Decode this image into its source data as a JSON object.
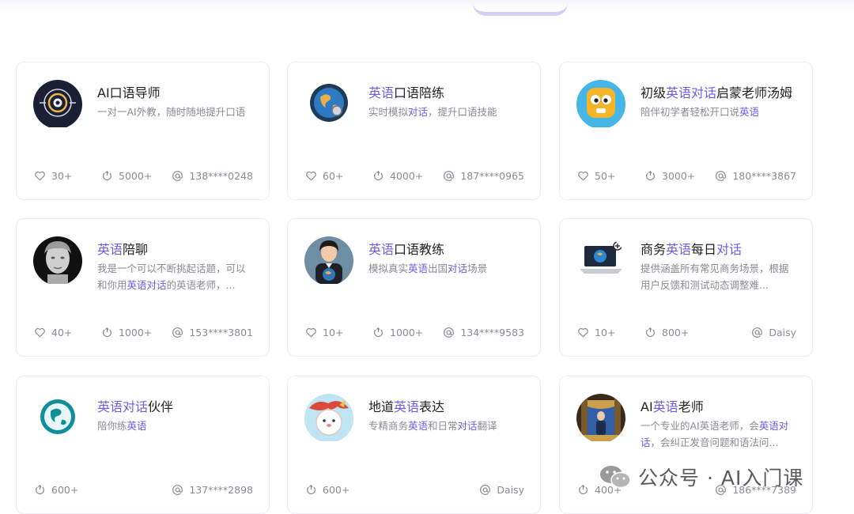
{
  "colors": {
    "accent": "#6b5ce7",
    "text": "#222222",
    "muted": "#8a8a92",
    "border": "#ececf1"
  },
  "cards": [
    {
      "title_parts": [
        {
          "t": "AI口语导师",
          "hl": false
        }
      ],
      "desc_parts": [
        {
          "t": "一对一AI外教，随时随地提升口语",
          "hl": false
        }
      ],
      "likes": "30+",
      "uses": "5000+",
      "author": "138****0248",
      "icon": "target-icon"
    },
    {
      "title_parts": [
        {
          "t": "英语",
          "hl": true
        },
        {
          "t": "口语陪练",
          "hl": false
        }
      ],
      "desc_parts": [
        {
          "t": "实时模拟",
          "hl": false
        },
        {
          "t": "对话",
          "hl": true
        },
        {
          "t": "，提升口语技能",
          "hl": false
        }
      ],
      "likes": "60+",
      "uses": "4000+",
      "author": "187****0965",
      "icon": "globe-icon"
    },
    {
      "title_parts": [
        {
          "t": "初级",
          "hl": false
        },
        {
          "t": "英语对话",
          "hl": true
        },
        {
          "t": "启蒙老师汤姆",
          "hl": false
        }
      ],
      "desc_parts": [
        {
          "t": "陪伴初学者轻松开口说",
          "hl": false
        },
        {
          "t": "英语",
          "hl": true
        }
      ],
      "likes": "50+",
      "uses": "3000+",
      "author": "180****3867",
      "icon": "robot-face-icon"
    },
    {
      "title_parts": [
        {
          "t": "英语",
          "hl": true
        },
        {
          "t": "陪聊",
          "hl": false
        }
      ],
      "desc_parts": [
        {
          "t": "我是一个可以不断挑起话题，可以和你用",
          "hl": false
        },
        {
          "t": "英语对话",
          "hl": true
        },
        {
          "t": "的英语老师，...",
          "hl": false
        }
      ],
      "likes": "40+",
      "uses": "1000+",
      "author": "153****3801",
      "icon": "statue-icon"
    },
    {
      "title_parts": [
        {
          "t": "英语",
          "hl": true
        },
        {
          "t": "口语教练",
          "hl": false
        }
      ],
      "desc_parts": [
        {
          "t": "模拟真实",
          "hl": false
        },
        {
          "t": "英语",
          "hl": true
        },
        {
          "t": "出国",
          "hl": false
        },
        {
          "t": "对话",
          "hl": true
        },
        {
          "t": "场景",
          "hl": false
        }
      ],
      "likes": "10+",
      "uses": "1000+",
      "author": "134****9583",
      "icon": "teacher-icon"
    },
    {
      "title_parts": [
        {
          "t": "商务",
          "hl": false
        },
        {
          "t": "英语",
          "hl": true
        },
        {
          "t": "每日",
          "hl": false
        },
        {
          "t": "对话",
          "hl": true
        }
      ],
      "desc_parts": [
        {
          "t": "提供涵盖所有常见商务场景，根据用户反馈和测试动态调整难...",
          "hl": false
        }
      ],
      "likes": "10+",
      "uses": "800+",
      "author": "Daisy",
      "icon": "laptop-icon"
    },
    {
      "title_parts": [
        {
          "t": "英语对话",
          "hl": true
        },
        {
          "t": "伙伴",
          "hl": false
        }
      ],
      "desc_parts": [
        {
          "t": "陪你练",
          "hl": false
        },
        {
          "t": "英语",
          "hl": true
        }
      ],
      "likes": "",
      "uses": "600+",
      "author": "137****2898",
      "icon": "earth-icon"
    },
    {
      "title_parts": [
        {
          "t": "地道",
          "hl": false
        },
        {
          "t": "英语",
          "hl": true
        },
        {
          "t": "表达",
          "hl": false
        }
      ],
      "desc_parts": [
        {
          "t": "专精商务",
          "hl": false
        },
        {
          "t": "英语",
          "hl": true
        },
        {
          "t": "和日常",
          "hl": false
        },
        {
          "t": "对话",
          "hl": true
        },
        {
          "t": "翻译",
          "hl": false
        }
      ],
      "likes": "",
      "uses": "600+",
      "author": "Daisy",
      "icon": "cartoon-icon"
    },
    {
      "title_parts": [
        {
          "t": "AI",
          "hl": false
        },
        {
          "t": "英语",
          "hl": true
        },
        {
          "t": "老师",
          "hl": false
        }
      ],
      "desc_parts": [
        {
          "t": "一个专业的AI英语老师，会",
          "hl": false
        },
        {
          "t": "英语对话",
          "hl": true
        },
        {
          "t": "，会纠正发音问题和语法问...",
          "hl": false
        }
      ],
      "likes": "",
      "uses": "400+",
      "author": "186****7389",
      "icon": "stage-icon"
    }
  ],
  "watermark": {
    "text": "公众号 · AI入门课",
    "icon": "wechat-icon"
  }
}
